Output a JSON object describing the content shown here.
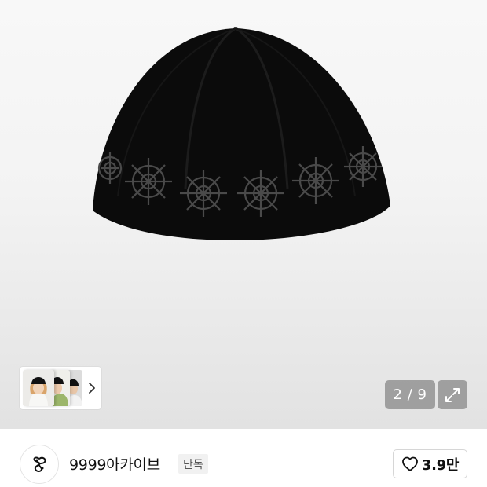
{
  "gallery": {
    "product_image": "black knit beanie with flower pattern",
    "page_indicator": "2 / 9",
    "thumbnails": [
      "thumb-model-front",
      "thumb-model-side",
      "thumb-model-back"
    ],
    "next_icon": "chevron-right-icon",
    "expand_icon": "expand-icon"
  },
  "brand": {
    "logo_icon": "brand-logo-icon",
    "name": "9999아카이브",
    "badge": "단독"
  },
  "like": {
    "icon": "heart-icon",
    "count": "3.9만"
  },
  "colors": {
    "indicator_bg": "#8c8c8c",
    "badge_bg": "#f1f1f1",
    "text": "#111111"
  }
}
